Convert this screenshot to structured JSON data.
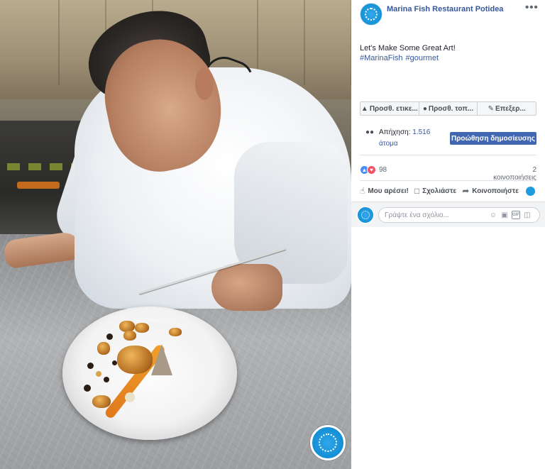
{
  "post": {
    "page_name": "Marina Fish Restaurant Potidea",
    "more_label": "•••",
    "text": "Let's Make Some Great Art!",
    "hashtags": [
      "#MarinaFish",
      "#gourmet"
    ]
  },
  "action_bar": {
    "tag_label": "Προσθ. ετικε...",
    "location_label": "Προσθ. τοπ...",
    "edit_label": "Επεξερ..."
  },
  "reach": {
    "label": "Απήχηση:",
    "count": "1.516",
    "unit": "άτομα",
    "boost_label": "Προώθηση δημοσίευσης"
  },
  "reactions": {
    "count": "98",
    "shares": "2 κοινοποιήσεις"
  },
  "ufi": {
    "like_label": "Μου αρέσει!",
    "comment_label": "Σχολιάστε",
    "share_label": "Κοινοποιήστε"
  },
  "comment": {
    "placeholder": "Γράψτε ένα σχόλιο..."
  },
  "icons": {
    "tag": "tag-icon",
    "location": "location-pin-icon",
    "edit": "pencil-icon",
    "people": "people-icon",
    "like": "thumbs-up-icon",
    "comment": "comment-bubble-icon",
    "share": "share-arrow-icon",
    "emoji": "emoji-icon",
    "camera": "camera-icon",
    "gif": "gif-icon",
    "sticker": "sticker-icon"
  },
  "colors": {
    "link": "#365899",
    "boost_button": "#4267b2",
    "brand_blue": "#1592d8"
  }
}
